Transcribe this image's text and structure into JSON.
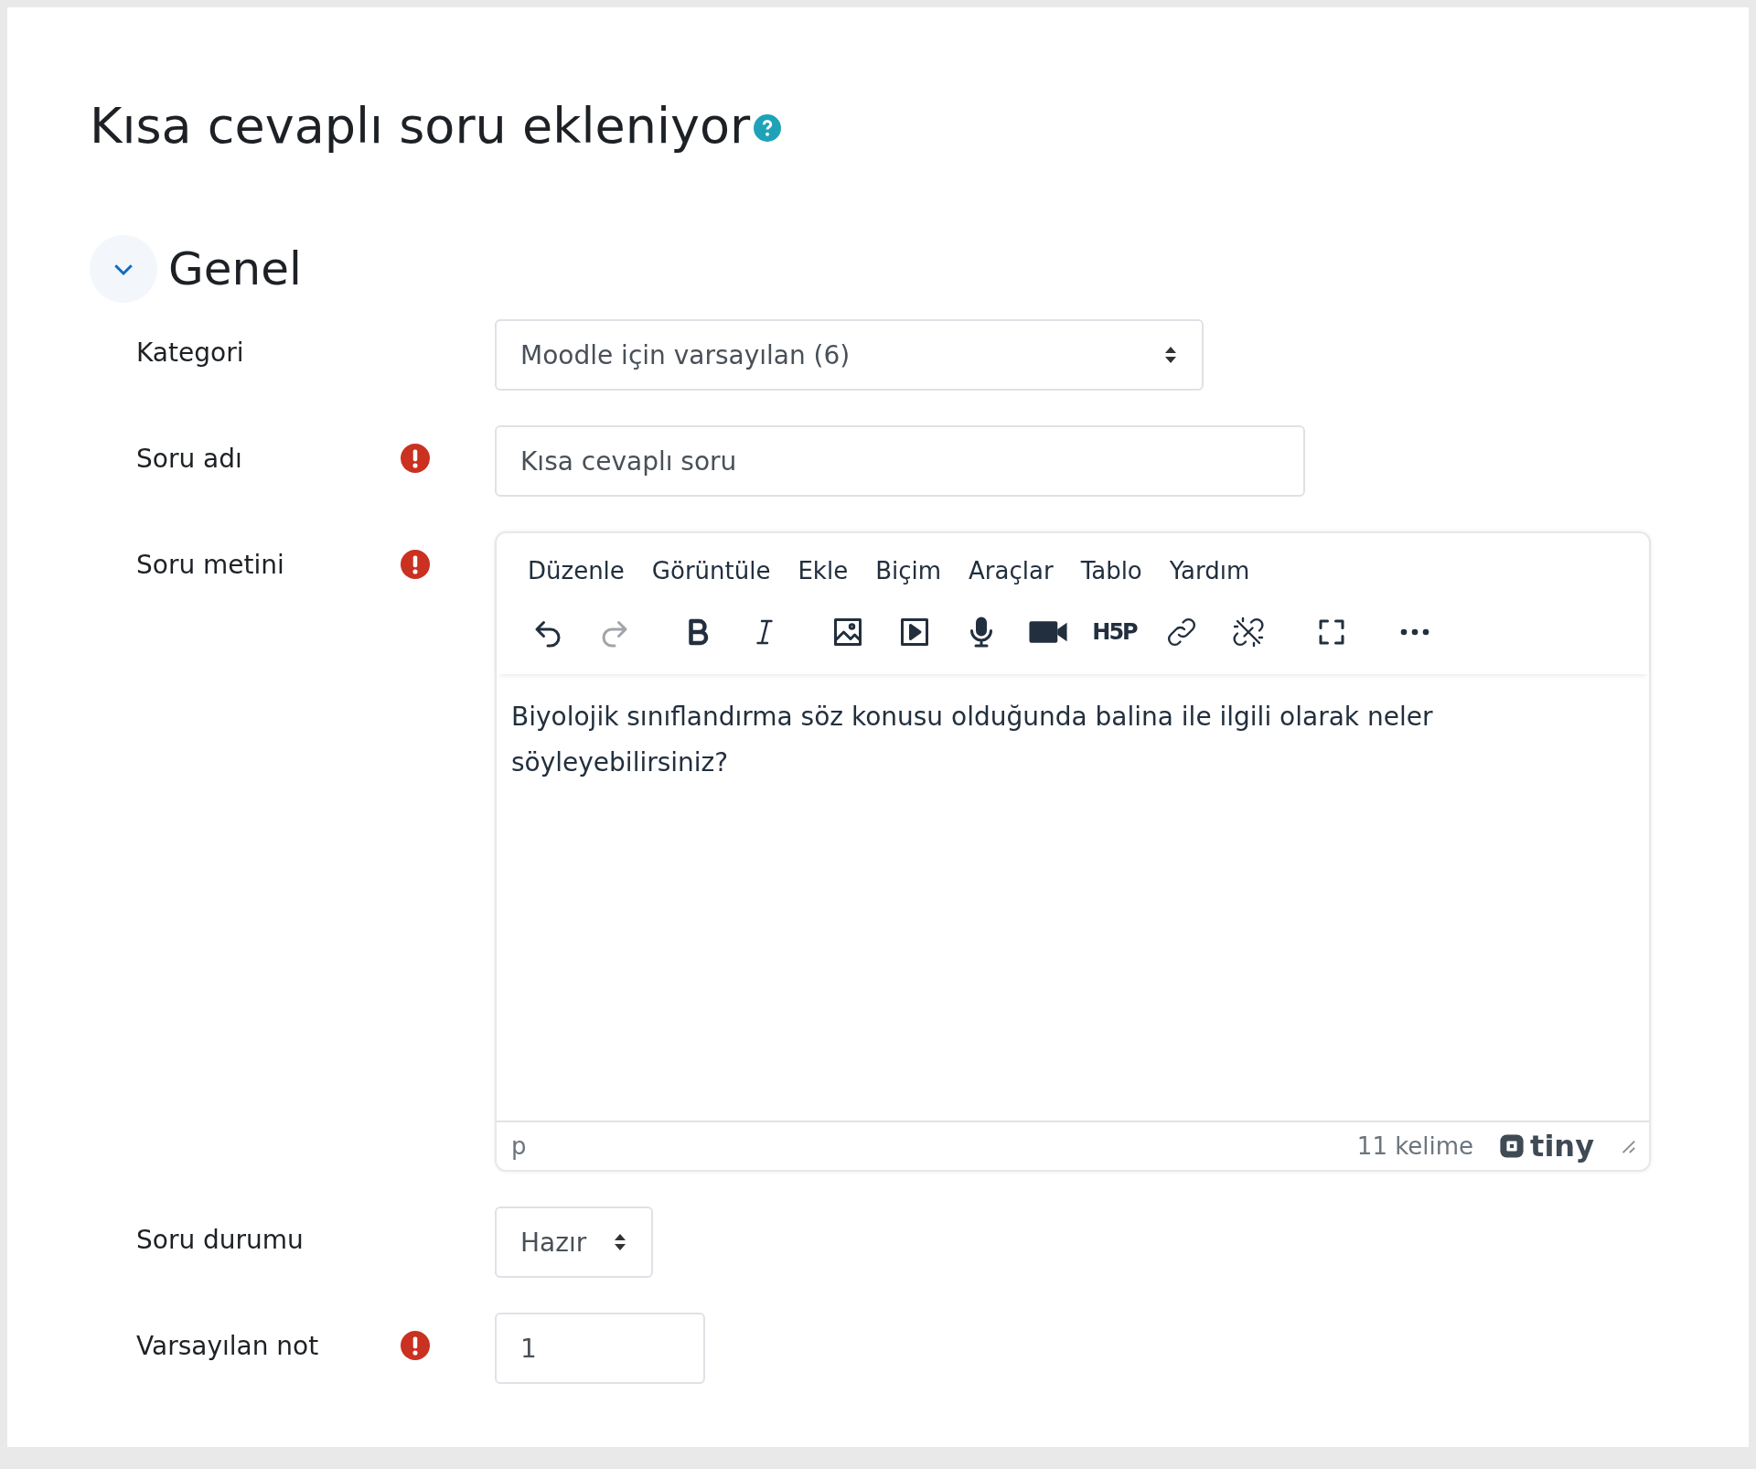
{
  "page": {
    "title": "Kısa cevaplı soru ekleniyor",
    "help": true
  },
  "section": {
    "title": "Genel",
    "expanded": true
  },
  "fields": [
    {
      "kind": "select",
      "label": "Kategori",
      "required": false,
      "value": "Moodle için varsayılan (6)"
    },
    {
      "kind": "text",
      "label": "Soru adı",
      "required": true,
      "value": "Kısa cevaplı soru"
    },
    {
      "kind": "editor",
      "label": "Soru metini",
      "required": true,
      "menu": [
        "Düzenle",
        "Görüntüle",
        "Ekle",
        "Biçim",
        "Araçlar",
        "Tablo",
        "Yardım"
      ],
      "toolbar": [
        [
          {
            "kind": "undo",
            "disabled": false
          },
          {
            "kind": "redo",
            "disabled": true
          }
        ],
        [
          {
            "kind": "bold",
            "disabled": false
          },
          {
            "kind": "italic",
            "disabled": false
          }
        ],
        [
          {
            "kind": "image",
            "disabled": false
          },
          {
            "kind": "media",
            "disabled": false
          },
          {
            "kind": "mic",
            "disabled": false
          },
          {
            "kind": "video",
            "disabled": false
          },
          {
            "kind": "h5p",
            "label": "H5P",
            "disabled": false
          },
          {
            "kind": "link",
            "disabled": false
          },
          {
            "kind": "unlink",
            "disabled": false
          }
        ],
        [
          {
            "kind": "fullscreen",
            "disabled": false
          }
        ],
        [
          {
            "kind": "more",
            "disabled": false
          }
        ]
      ],
      "content": "Biyolojik sınıflandırma söz konusu olduğunda balina ile ilgili olarak neler söyleyebilirsiniz?",
      "path": "p",
      "word_count": "11 kelime",
      "brand": "tiny"
    },
    {
      "kind": "select",
      "label": "Soru durumu",
      "required": false,
      "value": "Hazır"
    },
    {
      "kind": "text",
      "label": "Varsayılan not",
      "required": true,
      "value": "1"
    }
  ]
}
